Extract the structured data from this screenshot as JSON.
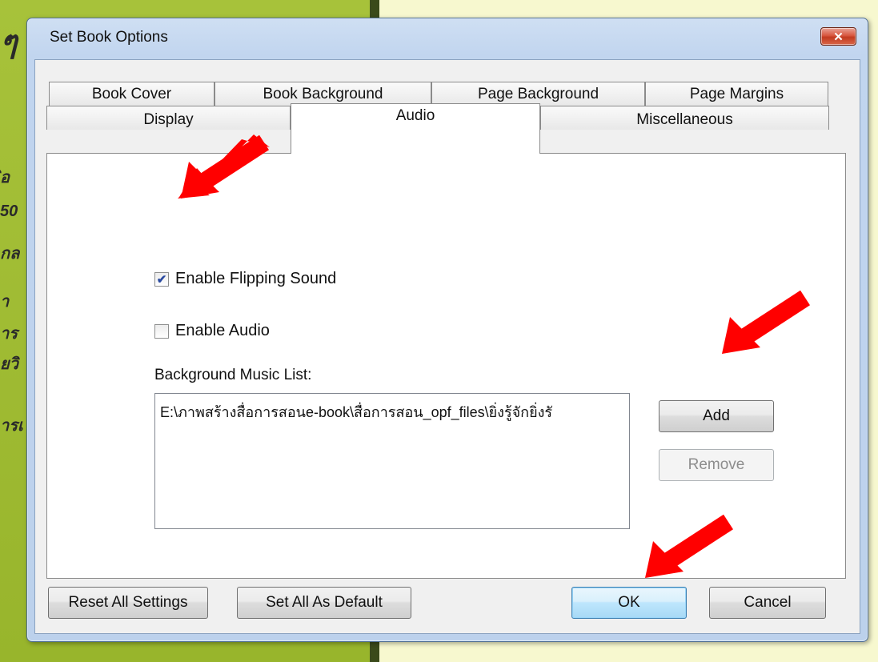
{
  "window": {
    "title": "Set Book Options",
    "close_label": "✕"
  },
  "background": {
    "snippets": [
      "ๆ",
      "ิอ",
      "50",
      "กล",
      "า",
      "าร",
      "ยวิ",
      "ารเ"
    ]
  },
  "tabs": {
    "row_top": [
      "Book Cover",
      "Book Background",
      "Page Background",
      "Page Margins"
    ],
    "row_bottom": [
      "Display",
      "Audio",
      "Miscellaneous"
    ],
    "active": "Audio"
  },
  "audio": {
    "enable_flipping_sound": {
      "label": "Enable Flipping Sound",
      "checked": true
    },
    "enable_audio": {
      "label": "Enable Audio",
      "checked": false
    },
    "music_list_label": "Background Music List:",
    "music_items": [
      "E:\\ภาพสร้างสื่อการสอนe-book\\สื่อการสอน_opf_files\\ยิ่งรู้จักยิ่งรั"
    ],
    "add_label": "Add",
    "remove_label": "Remove"
  },
  "footer": {
    "reset_label": "Reset All Settings",
    "set_default_label": "Set All As Default",
    "ok_label": "OK",
    "cancel_label": "Cancel"
  },
  "colors": {
    "arrow": "#ff0000",
    "window_frame": "#c1d5ef",
    "close_button": "#d8573f"
  },
  "icons": {
    "check": "checkmark-icon",
    "arrow": "red-arrow-icon"
  }
}
